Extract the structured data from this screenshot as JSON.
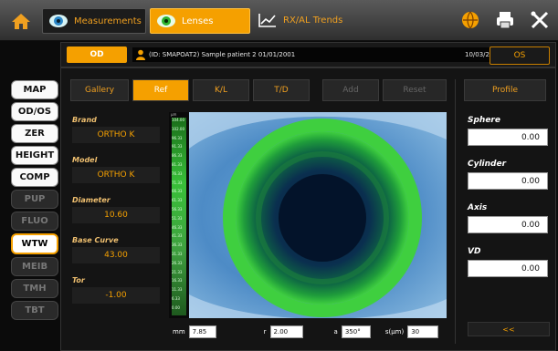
{
  "tabs": [
    {
      "label": "Measurements"
    },
    {
      "label": "Lenses"
    },
    {
      "label": "RX/AL Trends"
    }
  ],
  "eye_bar": {
    "od_label": "OD",
    "os_label": "OS",
    "patient": "(ID: SMAPOAT2) Sample patient 2 01/01/2001",
    "datetime": "10/03/2020 15:18:41"
  },
  "sidebar": [
    {
      "label": "MAP",
      "state": "enabled"
    },
    {
      "label": "OD/OS",
      "state": "enabled"
    },
    {
      "label": "ZER",
      "state": "enabled"
    },
    {
      "label": "HEIGHT",
      "state": "enabled"
    },
    {
      "label": "COMP",
      "state": "enabled"
    },
    {
      "label": "PUP",
      "state": "disabled"
    },
    {
      "label": "FLUO",
      "state": "disabled"
    },
    {
      "label": "WTW",
      "state": "active"
    },
    {
      "label": "MEIB",
      "state": "disabled"
    },
    {
      "label": "TMH",
      "state": "disabled"
    },
    {
      "label": "TBT",
      "state": "disabled"
    }
  ],
  "toolbar": {
    "gallery": "Gallery",
    "ref": "Ref",
    "kl": "K/L",
    "td": "T/D",
    "add": "Add",
    "reset": "Reset",
    "profile": "Profile"
  },
  "lens_fields": {
    "brand_label": "Brand",
    "brand_value": "ORTHO K",
    "model_label": "Model",
    "model_value": "ORTHO K",
    "diameter_label": "Diameter",
    "diameter_value": "10.60",
    "base_curve_label": "Base Curve",
    "base_curve_value": "43.00",
    "tor_label": "Tor",
    "tor_value": "-1.00"
  },
  "refraction": {
    "sphere_label": "Sphere",
    "sphere_value": "0.00",
    "cylinder_label": "Cylinder",
    "cylinder_value": "0.00",
    "axis_label": "Axis",
    "axis_value": "0.00",
    "vd_label": "VD",
    "vd_value": "0.00",
    "collapse": "<<"
  },
  "scale": {
    "unit": "µm",
    "ticks": [
      "104.00",
      "102.00",
      "96.33",
      "91.33",
      "86.33",
      "81.33",
      "76.33",
      "71.33",
      "66.33",
      "61.33",
      "56.33",
      "51.33",
      "46.33",
      "41.33",
      "36.33",
      "31.33",
      "26.33",
      "21.33",
      "16.33",
      "11.33",
      "6.33",
      "0.00"
    ]
  },
  "bottom": {
    "mm_label": "mm",
    "mm_value": "7.85",
    "r_label": "r",
    "r_value": "2.00",
    "a_label": "a",
    "a_value": "350°",
    "s_label": "s(µm)",
    "s_value": "30"
  },
  "colors": {
    "accent": "#f5a000",
    "lens_ring": "#3fcf3f"
  }
}
